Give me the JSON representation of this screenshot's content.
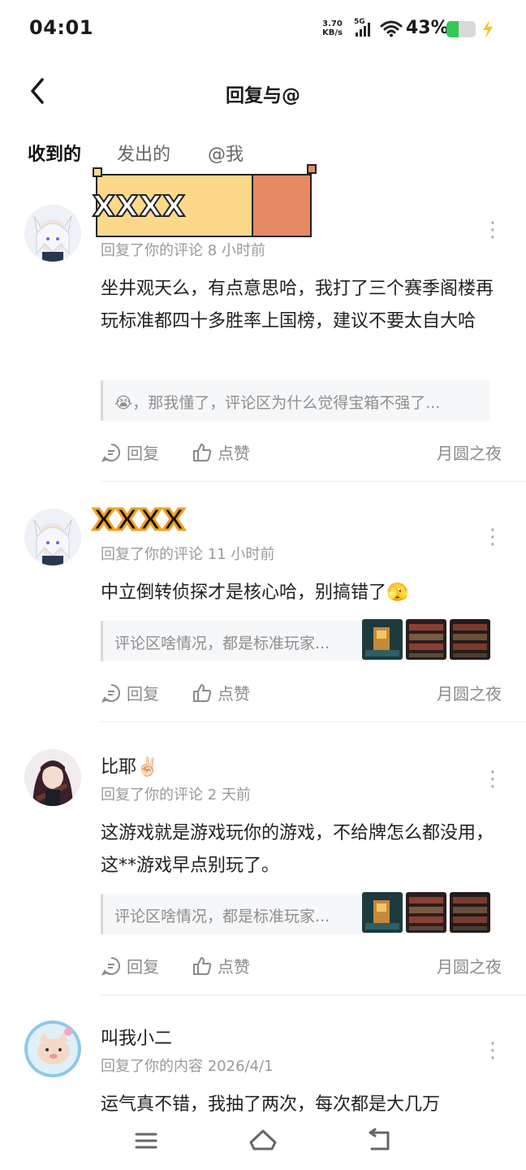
{
  "status_bar": {
    "time": "04:01",
    "net_speed_value": "3.70",
    "net_speed_unit": "KB/s",
    "network": "5G",
    "battery_percent": "43%",
    "battery_level": 0.43
  },
  "header": {
    "title": "回复与@"
  },
  "tabs": [
    {
      "label": "收到的",
      "active": true
    },
    {
      "label": "发出的",
      "active": false
    },
    {
      "label": "@我",
      "active": false
    }
  ],
  "items": [
    {
      "username": "XXXX",
      "meta": "回复了你的评论 8 小时前",
      "text": "坐井观天么，有点意思哈，我打了三个赛季阁楼再玩标准都四十多胜率上国榜，建议不要太自大哈",
      "quote": "😭，那我懂了，评论区为什么觉得宝箱不强了...",
      "reply_label": "回复",
      "like_label": "点赞",
      "source": "月圆之夜"
    },
    {
      "username": "XXXX",
      "meta": "回复了你的评论 11 小时前",
      "text": "中立倒转侦探才是核心哈，别搞错了🫣",
      "quote": "评论区啥情况，都是标准玩家...",
      "reply_label": "回复",
      "like_label": "点赞",
      "source": "月圆之夜"
    },
    {
      "username": "比耶✌🏻",
      "meta": "回复了你的评论 2 天前",
      "text": "这游戏就是游戏玩你的游戏，不给牌怎么都没用，这**游戏早点别玩了。",
      "quote": "评论区啥情况，都是标准玩家...",
      "reply_label": "回复",
      "like_label": "点赞",
      "source": "月圆之夜"
    },
    {
      "username": "叫我小二",
      "meta": "回复了你的内容 2026/4/1",
      "text": "运气真不错，我抽了两次，每次都是大几万"
    }
  ],
  "colors": {
    "accent": "#20d0c4",
    "redact_light": "#fcd98a",
    "redact_dark": "#e58a63",
    "battery": "#34c759"
  },
  "icons": [
    "back-icon",
    "reply-icon",
    "like-icon",
    "more-icon",
    "menu-icon",
    "home-icon",
    "back-nav-icon",
    "wifi-icon",
    "signal-icon",
    "charging-icon"
  ]
}
